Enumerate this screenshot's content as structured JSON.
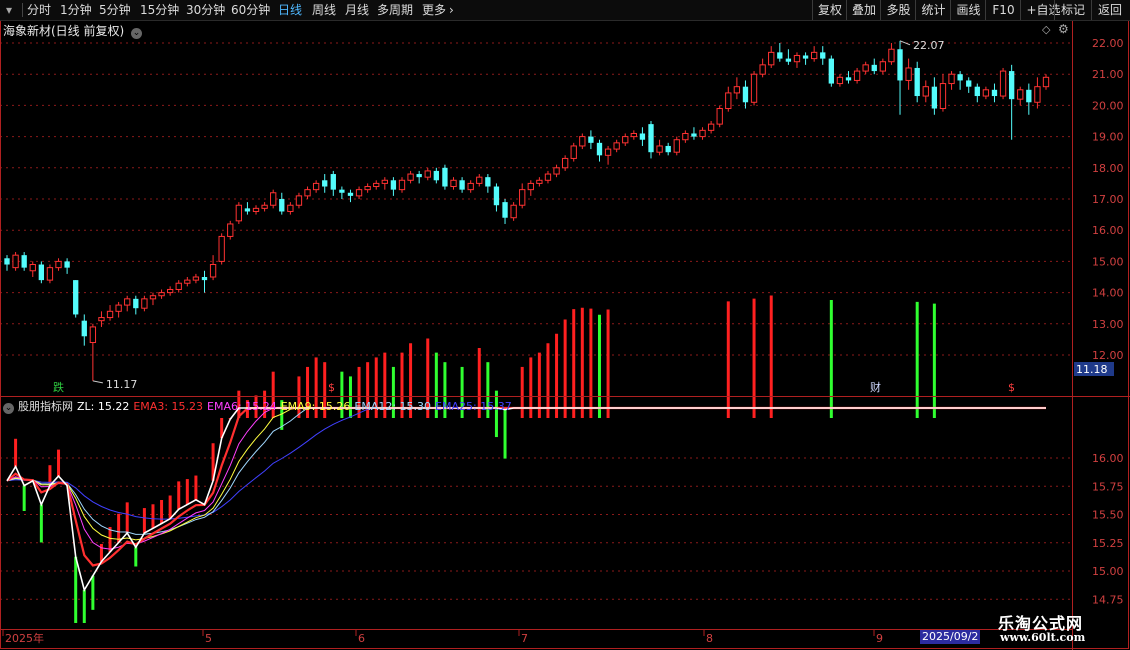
{
  "toolbar": {
    "left": [
      {
        "label": "分时",
        "active": false
      },
      {
        "label": "1分钟",
        "active": false
      },
      {
        "label": "5分钟",
        "active": false
      },
      {
        "label": "15分钟",
        "active": false
      },
      {
        "label": "30分钟",
        "active": false
      },
      {
        "label": "60分钟",
        "active": false
      },
      {
        "label": "日线",
        "active": true
      },
      {
        "label": "周线",
        "active": false
      },
      {
        "label": "月线",
        "active": false
      },
      {
        "label": "多周期",
        "active": false
      },
      {
        "label": "更多",
        "active": false
      }
    ],
    "right": [
      "复权",
      "叠加",
      "多股",
      "统计",
      "画线",
      "F10",
      "+自选",
      "返回"
    ],
    "more_icon": "chevron-right-icon",
    "menu_icon": "caret-down-icon"
  },
  "stock": {
    "title": "海象新材(日线 前复权)",
    "title_icon": "chevron-down-icon",
    "high_label": "22.07",
    "low_label": "11.17",
    "current_price": "11.18"
  },
  "price_axis": [
    "22.00",
    "21.00",
    "20.00",
    "19.00",
    "18.00",
    "17.00",
    "16.00",
    "15.00",
    "14.00",
    "13.00",
    "12.00"
  ],
  "markers": [
    {
      "text": "跌",
      "color": "#2ecc40"
    },
    {
      "text": "$",
      "color": "#ff4040"
    },
    {
      "text": "财",
      "color": "#cfd8ff"
    },
    {
      "text": "$",
      "color": "#ff4040"
    }
  ],
  "indicator": {
    "name": "股朋指标网",
    "icon": "chevron-down-icon",
    "values": [
      {
        "label": "ZL: 15.22",
        "color": "#ffffff"
      },
      {
        "label": "EMA3: 15.23",
        "color": "#ff3030"
      },
      {
        "label": "EMA6: 15.24",
        "color": "#ff40ff"
      },
      {
        "label": "EMA9: 15.26",
        "color": "#ffff40"
      },
      {
        "label": "EMA12: 15.30",
        "color": "#a0d8ff"
      },
      {
        "label": "EMA25: 15.37",
        "color": "#4040ff"
      }
    ],
    "axis": [
      "16.00",
      "15.75",
      "15.50",
      "15.25",
      "15.00",
      "14.75"
    ]
  },
  "time_axis": [
    "2025年",
    "5",
    "6",
    "7",
    "8",
    "9"
  ],
  "date_badge": "2025/09/2",
  "watermark": {
    "line1": "乐淘公式网",
    "line2": "www.60lt.com"
  },
  "colors": {
    "up": "#ff3232",
    "down": "#54fcfc",
    "grid": "#8b1a1a",
    "axis_text": "#d04040"
  },
  "chart_data": {
    "type": "candlestick",
    "ylim": [
      11.6,
      22.3
    ],
    "candles": [
      [
        15.1,
        14.9,
        15.2,
        14.7
      ],
      [
        14.8,
        15.2,
        15.3,
        14.7
      ],
      [
        15.2,
        14.8,
        15.3,
        14.7
      ],
      [
        14.7,
        14.9,
        15.0,
        14.5
      ],
      [
        14.9,
        14.4,
        15.0,
        14.3
      ],
      [
        14.4,
        14.8,
        14.9,
        14.3
      ],
      [
        14.8,
        15.0,
        15.1,
        14.7
      ],
      [
        15.0,
        14.8,
        15.1,
        14.6
      ],
      [
        14.4,
        13.3,
        14.4,
        13.2
      ],
      [
        13.1,
        12.6,
        13.3,
        12.3
      ],
      [
        12.4,
        12.9,
        13.0,
        11.17
      ],
      [
        13.1,
        13.2,
        13.4,
        12.9
      ],
      [
        13.2,
        13.4,
        13.6,
        13.1
      ],
      [
        13.4,
        13.6,
        13.7,
        13.2
      ],
      [
        13.6,
        13.8,
        13.9,
        13.4
      ],
      [
        13.8,
        13.5,
        13.9,
        13.3
      ],
      [
        13.5,
        13.8,
        13.9,
        13.4
      ],
      [
        13.8,
        13.9,
        14.0,
        13.6
      ],
      [
        13.9,
        14.0,
        14.1,
        13.8
      ],
      [
        14.0,
        14.1,
        14.2,
        13.9
      ],
      [
        14.1,
        14.3,
        14.4,
        14.0
      ],
      [
        14.3,
        14.4,
        14.5,
        14.2
      ],
      [
        14.4,
        14.5,
        14.6,
        14.3
      ],
      [
        14.5,
        14.4,
        14.7,
        14.0
      ],
      [
        14.5,
        14.9,
        15.2,
        14.4
      ],
      [
        15.0,
        15.8,
        15.9,
        14.9
      ],
      [
        15.8,
        16.2,
        16.3,
        15.7
      ],
      [
        16.3,
        16.8,
        16.9,
        16.2
      ],
      [
        16.7,
        16.6,
        16.9,
        16.5
      ],
      [
        16.6,
        16.7,
        16.8,
        16.5
      ],
      [
        16.7,
        16.8,
        16.9,
        16.6
      ],
      [
        16.8,
        17.2,
        17.3,
        16.7
      ],
      [
        17.0,
        16.6,
        17.2,
        16.5
      ],
      [
        16.6,
        16.8,
        16.9,
        16.5
      ],
      [
        16.8,
        17.1,
        17.2,
        16.7
      ],
      [
        17.1,
        17.3,
        17.4,
        17.0
      ],
      [
        17.3,
        17.5,
        17.6,
        17.2
      ],
      [
        17.6,
        17.4,
        17.8,
        17.2
      ],
      [
        17.8,
        17.3,
        17.9,
        17.1
      ],
      [
        17.3,
        17.2,
        17.4,
        17.0
      ],
      [
        17.2,
        17.1,
        17.3,
        16.9
      ],
      [
        17.1,
        17.3,
        17.4,
        17.0
      ],
      [
        17.3,
        17.4,
        17.5,
        17.2
      ],
      [
        17.4,
        17.5,
        17.6,
        17.3
      ],
      [
        17.5,
        17.6,
        17.7,
        17.3
      ],
      [
        17.6,
        17.3,
        17.7,
        17.1
      ],
      [
        17.3,
        17.6,
        17.7,
        17.2
      ],
      [
        17.6,
        17.8,
        17.9,
        17.5
      ],
      [
        17.8,
        17.7,
        17.9,
        17.5
      ],
      [
        17.7,
        17.9,
        18.0,
        17.6
      ],
      [
        17.9,
        17.6,
        18.0,
        17.5
      ],
      [
        18.0,
        17.4,
        18.1,
        17.3
      ],
      [
        17.4,
        17.6,
        17.7,
        17.3
      ],
      [
        17.6,
        17.3,
        17.7,
        17.2
      ],
      [
        17.3,
        17.5,
        17.6,
        17.2
      ],
      [
        17.5,
        17.7,
        17.8,
        17.4
      ],
      [
        17.7,
        17.4,
        17.8,
        17.2
      ],
      [
        17.4,
        16.8,
        17.5,
        16.6
      ],
      [
        16.9,
        16.4,
        17.0,
        16.2
      ],
      [
        16.4,
        16.8,
        16.9,
        16.3
      ],
      [
        16.8,
        17.3,
        17.5,
        16.7
      ],
      [
        17.3,
        17.5,
        17.6,
        17.1
      ],
      [
        17.5,
        17.6,
        17.7,
        17.4
      ],
      [
        17.6,
        17.8,
        17.9,
        17.5
      ],
      [
        17.8,
        18.0,
        18.1,
        17.7
      ],
      [
        18.0,
        18.3,
        18.4,
        17.9
      ],
      [
        18.3,
        18.7,
        18.8,
        18.2
      ],
      [
        18.7,
        19.0,
        19.1,
        18.6
      ],
      [
        19.0,
        18.8,
        19.2,
        18.6
      ],
      [
        18.8,
        18.4,
        18.9,
        18.2
      ],
      [
        18.4,
        18.6,
        18.7,
        18.1
      ],
      [
        18.6,
        18.8,
        18.9,
        18.5
      ],
      [
        18.8,
        19.0,
        19.1,
        18.7
      ],
      [
        19.0,
        19.1,
        19.2,
        18.9
      ],
      [
        19.1,
        18.9,
        19.3,
        18.7
      ],
      [
        19.4,
        18.5,
        19.5,
        18.3
      ],
      [
        18.5,
        18.7,
        18.9,
        18.4
      ],
      [
        18.7,
        18.5,
        18.8,
        18.4
      ],
      [
        18.5,
        18.9,
        19.0,
        18.4
      ],
      [
        18.9,
        19.1,
        19.2,
        18.8
      ],
      [
        19.1,
        19.0,
        19.3,
        18.9
      ],
      [
        19.0,
        19.2,
        19.3,
        18.9
      ],
      [
        19.2,
        19.4,
        19.5,
        19.1
      ],
      [
        19.4,
        19.9,
        20.0,
        19.3
      ],
      [
        19.9,
        20.4,
        20.6,
        19.8
      ],
      [
        20.4,
        20.6,
        20.9,
        20.2
      ],
      [
        20.6,
        20.1,
        20.8,
        19.9
      ],
      [
        20.1,
        21.0,
        21.1,
        20.0
      ],
      [
        21.0,
        21.3,
        21.5,
        20.9
      ],
      [
        21.3,
        21.7,
        21.9,
        21.2
      ],
      [
        21.7,
        21.5,
        22.0,
        21.4
      ],
      [
        21.5,
        21.4,
        21.8,
        21.3
      ],
      [
        21.4,
        21.6,
        21.7,
        21.2
      ],
      [
        21.6,
        21.5,
        21.7,
        21.3
      ],
      [
        21.5,
        21.7,
        21.9,
        21.4
      ],
      [
        21.7,
        21.5,
        21.9,
        21.3
      ],
      [
        21.5,
        20.7,
        21.6,
        20.6
      ],
      [
        20.7,
        20.9,
        21.0,
        20.6
      ],
      [
        20.9,
        20.8,
        21.1,
        20.7
      ],
      [
        20.8,
        21.1,
        21.2,
        20.7
      ],
      [
        21.1,
        21.3,
        21.4,
        21.0
      ],
      [
        21.3,
        21.1,
        21.5,
        21.0
      ],
      [
        21.1,
        21.4,
        21.5,
        21.0
      ],
      [
        21.4,
        21.8,
        22.0,
        21.3
      ],
      [
        21.8,
        20.8,
        22.07,
        19.7
      ],
      [
        20.8,
        21.2,
        21.5,
        20.5
      ],
      [
        21.2,
        20.3,
        21.4,
        20.1
      ],
      [
        20.3,
        20.6,
        20.8,
        20.1
      ],
      [
        20.6,
        19.9,
        20.9,
        19.7
      ],
      [
        19.9,
        20.7,
        21.0,
        19.8
      ],
      [
        20.7,
        21.0,
        21.1,
        20.5
      ],
      [
        21.0,
        20.8,
        21.1,
        20.5
      ],
      [
        20.8,
        20.6,
        20.9,
        20.4
      ],
      [
        20.6,
        20.3,
        20.7,
        20.1
      ],
      [
        20.3,
        20.5,
        20.6,
        20.2
      ],
      [
        20.5,
        20.3,
        20.7,
        20.1
      ],
      [
        20.3,
        21.1,
        21.2,
        20.2
      ],
      [
        21.1,
        20.2,
        21.3,
        18.9
      ],
      [
        20.2,
        20.5,
        20.6,
        20.0
      ],
      [
        20.5,
        20.1,
        20.7,
        19.7
      ],
      [
        20.1,
        20.6,
        20.9,
        19.9
      ],
      [
        20.6,
        20.9,
        21.0,
        20.5
      ]
    ]
  }
}
